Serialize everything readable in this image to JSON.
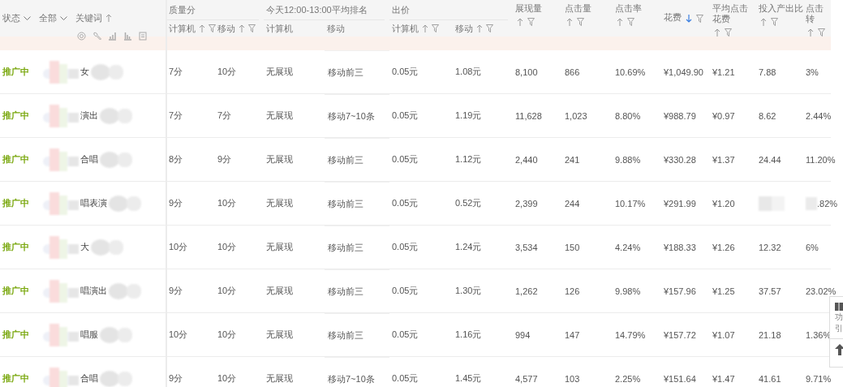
{
  "header": {
    "status_filter": "状态",
    "scope_filter": "全部",
    "keyword": {
      "label": "关键词",
      "sortable": true
    },
    "column_groups": [
      {
        "label": "质量分",
        "columns": [
          {
            "label": "计算机",
            "sortable": true,
            "filter": true
          },
          {
            "label": "移动",
            "sortable": true,
            "filter": true
          }
        ]
      },
      {
        "label": "今天12:00-13:00平均排名",
        "columns": [
          {
            "label": "计算机"
          },
          {
            "label": "移动"
          }
        ]
      },
      {
        "label": "出价",
        "columns": [
          {
            "label": "计算机",
            "sortable": true,
            "filter": true
          },
          {
            "label": "移动",
            "sortable": true,
            "filter": true
          }
        ]
      }
    ],
    "metric_columns": [
      {
        "label": "展现量",
        "sortable": true,
        "descending": false,
        "filter": true
      },
      {
        "label": "点击量",
        "sortable": true,
        "descending": false,
        "filter": true
      },
      {
        "label": "点击率",
        "sortable": true,
        "descending": false,
        "filter": true
      },
      {
        "label": "花费",
        "sortable": true,
        "descending": true,
        "filter": true
      },
      {
        "label": "平均点击花费",
        "sortable": true,
        "descending": false,
        "filter": true
      },
      {
        "label": "投入产出比",
        "sortable": true,
        "descending": false,
        "filter": true
      },
      {
        "label": "点击转",
        "sortable": true,
        "descending": false,
        "filter": true
      }
    ]
  },
  "rows": [
    {
      "status": "推广中",
      "keyword": "女",
      "cells": [
        "7分",
        "10分",
        "无展现",
        "移动前三",
        "0.05元",
        "1.08元",
        "8,100",
        "866",
        "10.69%",
        "¥1,049.90",
        "¥1.21",
        "7.88",
        "3%"
      ]
    },
    {
      "status": "推广中",
      "keyword": "演出",
      "cells": [
        "7分",
        "7分",
        "无展现",
        "移动7~10条",
        "0.05元",
        "1.19元",
        "11,628",
        "1,023",
        "8.80%",
        "¥988.79",
        "¥0.97",
        "8.62",
        "2.44%"
      ]
    },
    {
      "status": "推广中",
      "keyword": "合唱",
      "cells": [
        "8分",
        "9分",
        "无展现",
        "移动前三",
        "0.05元",
        "1.12元",
        "2,440",
        "241",
        "9.88%",
        "¥330.28",
        "¥1.37",
        "24.44",
        "11.20%"
      ]
    },
    {
      "status": "推广中",
      "keyword": "唱表演",
      "cells": [
        "9分",
        "10分",
        "无展现",
        "移动前三",
        "0.05元",
        "0.52元",
        "2,399",
        "244",
        "10.17%",
        "¥291.99",
        "¥1.20",
        null,
        ".82%"
      ]
    },
    {
      "status": "推广中",
      "keyword": "大",
      "cells": [
        "10分",
        "10分",
        "无展现",
        "移动前三",
        "0.05元",
        "1.24元",
        "3,534",
        "150",
        "4.24%",
        "¥188.33",
        "¥1.26",
        "12.32",
        "6%"
      ]
    },
    {
      "status": "推广中",
      "keyword": "唱演出",
      "cells": [
        "9分",
        "10分",
        "无展现",
        "移动前三",
        "0.05元",
        "1.30元",
        "1,262",
        "126",
        "9.98%",
        "¥157.96",
        "¥1.25",
        "37.57",
        "23.02%"
      ]
    },
    {
      "status": "推广中",
      "keyword": "唱服",
      "cells": [
        "10分",
        "10分",
        "无展现",
        "移动前三",
        "0.05元",
        "1.16元",
        "994",
        "147",
        "14.79%",
        "¥157.72",
        "¥1.07",
        "21.18",
        "1.36%"
      ]
    },
    {
      "status": "推广中",
      "keyword": "合唱",
      "cells": [
        "9分",
        "10分",
        "无展现",
        "移动7~10条",
        "0.05元",
        "1.45元",
        "4,577",
        "103",
        "2.25%",
        "¥151.64",
        "¥1.47",
        "41.61",
        "9.71%"
      ]
    }
  ],
  "side_widget": {
    "lines": [
      "功",
      "引"
    ]
  }
}
